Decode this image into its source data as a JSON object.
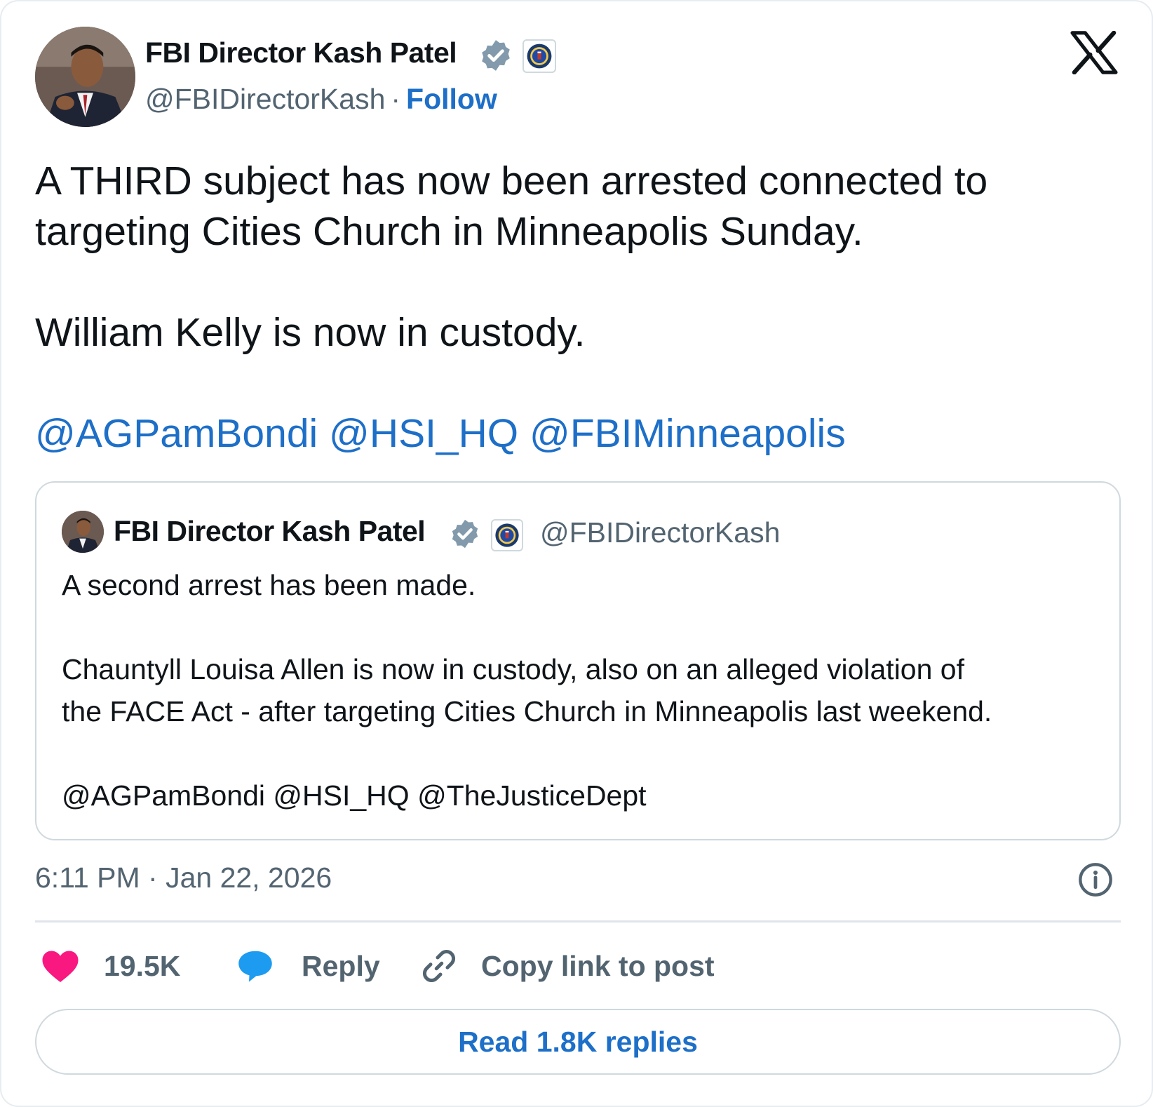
{
  "author": {
    "name": "FBI Director Kash Patel",
    "handle": "@FBIDirectorKash",
    "separator": "·",
    "follow_label": "Follow"
  },
  "icons": {
    "verified": "verified-badge-icon",
    "affiliation": "fbi-seal-icon",
    "brand": "x-logo-icon",
    "info": "info-icon",
    "like": "heart-icon",
    "reply": "speech-bubble-icon",
    "copy": "link-icon"
  },
  "colors": {
    "link": "#1d6fc8",
    "like": "#f91880",
    "reply": "#1d9bf0",
    "muted": "#536471",
    "verified": "#829aab"
  },
  "tweet": {
    "line1": "A THIRD subject has now been arrested connected to",
    "line2": "targeting Cities Church in Minneapolis Sunday.",
    "line3": "William Kelly is now in custody.",
    "mentions": [
      "@AGPamBondi",
      "@HSI_HQ",
      "@FBIMinneapolis"
    ]
  },
  "quote": {
    "name": "FBI Director Kash Patel",
    "handle": "@FBIDirectorKash",
    "line1": "A second arrest has been made.",
    "line2": "Chauntyll Louisa Allen is now in custody, also on an alleged violation of",
    "line3": "the FACE Act - after targeting Cities Church in Minneapolis last weekend.",
    "line4": "@AGPamBondi @HSI_HQ @TheJusticeDept"
  },
  "timestamp": "6:11 PM · Jan 22, 2026",
  "actions": {
    "likes": "19.5K",
    "reply_label": "Reply",
    "copy_label": "Copy link to post"
  },
  "read_replies": "Read 1.8K replies"
}
